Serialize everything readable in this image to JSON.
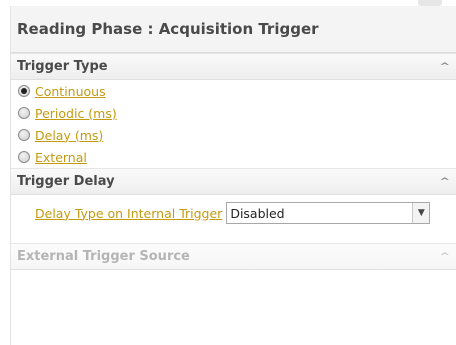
{
  "panel": {
    "title": "Reading Phase :  Acquisition Trigger"
  },
  "sections": {
    "trigger_type": {
      "label": "Trigger Type",
      "options": [
        {
          "label": "Continuous",
          "selected": true
        },
        {
          "label": "Periodic (ms)",
          "selected": false
        },
        {
          "label": "Delay (ms)",
          "selected": false
        },
        {
          "label": "External",
          "selected": false
        }
      ]
    },
    "trigger_delay": {
      "label": "Trigger Delay",
      "delay_type_label": "Delay Type on Internal Trigger",
      "delay_type_value": "Disabled"
    },
    "external_source": {
      "label": "External Trigger Source",
      "disabled": true
    }
  },
  "icons": {
    "collapse": "chevron-up-icon",
    "dropdown": "chevron-down-icon",
    "radio": "radio-icon"
  },
  "colors": {
    "link": "#c49a10",
    "header_bg": "#f4f4f4",
    "disabled_text": "#b5b5b5"
  }
}
